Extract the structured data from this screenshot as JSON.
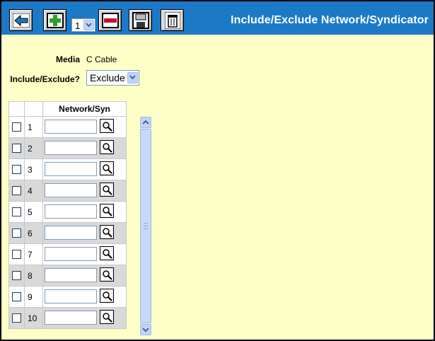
{
  "title": "Include/Exclude Network/Syndicator",
  "toolbar": {
    "back": "back-arrow-icon",
    "add": "plus-icon",
    "count_value": "1",
    "remove": "minus-icon",
    "save": "save-icon",
    "delete": "trash-icon"
  },
  "form": {
    "media_label": "Media",
    "media_value": "C Cable",
    "include_exclude_label": "Include/Exclude?",
    "include_exclude_value": "Exclude"
  },
  "grid": {
    "header_network": "Network/Syn",
    "rows": [
      {
        "num": "1",
        "value": ""
      },
      {
        "num": "2",
        "value": ""
      },
      {
        "num": "3",
        "value": ""
      },
      {
        "num": "4",
        "value": ""
      },
      {
        "num": "5",
        "value": ""
      },
      {
        "num": "6",
        "value": ""
      },
      {
        "num": "7",
        "value": ""
      },
      {
        "num": "8",
        "value": ""
      },
      {
        "num": "9",
        "value": ""
      },
      {
        "num": "10",
        "value": ""
      }
    ]
  },
  "colors": {
    "toolbar_bg": "#1c79c6",
    "page_bg": "#ffffc8",
    "row_alt": "#d9d9d9"
  }
}
